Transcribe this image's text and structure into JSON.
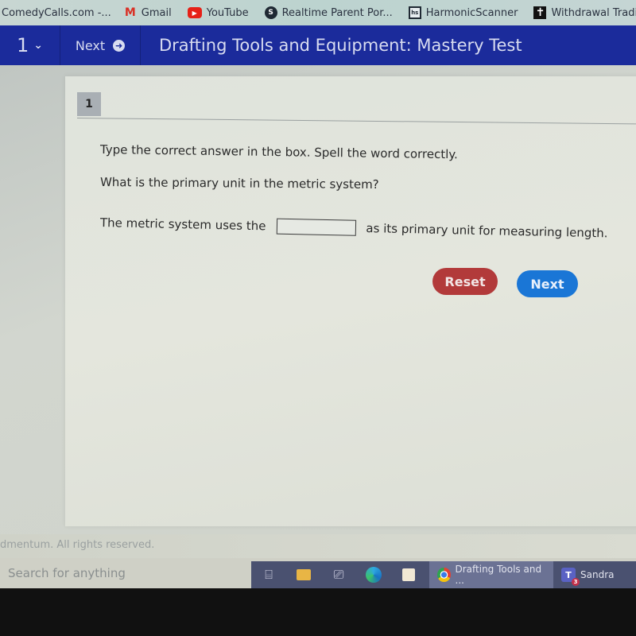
{
  "bookmarks": [
    {
      "label": "ComedyCalls.com -...",
      "icon": "none"
    },
    {
      "label": "Gmail",
      "icon": "gmail-icon"
    },
    {
      "label": "YouTube",
      "icon": "youtube-icon"
    },
    {
      "label": "Realtime Parent Por...",
      "icon": "realtime-parent-icon"
    },
    {
      "label": "HarmonicScanner",
      "icon": "harmonic-scanner-icon"
    },
    {
      "label": "Withdrawal Trading...",
      "icon": "withdrawal-trading-icon"
    }
  ],
  "header": {
    "question_selector": "1",
    "next_label": "Next",
    "title": "Drafting Tools and Equipment: Mastery Test"
  },
  "question": {
    "number": "1",
    "instruction": "Type the correct answer in the box. Spell the word correctly.",
    "prompt": "What is the primary unit in the metric system?",
    "sentence_before": "The metric system uses the",
    "answer_value": "",
    "sentence_after": "as its primary unit for measuring length.",
    "reset_label": "Reset",
    "next_label": "Next"
  },
  "footer": {
    "copyright": "dmentum. All rights reserved."
  },
  "taskbar": {
    "search_placeholder": "Search for anything",
    "active_window": "Drafting Tools and ...",
    "teams_label": "Sandra",
    "teams_badge": "3"
  },
  "colors": {
    "header_bg": "#1b2b9b",
    "reset_button": "#b23a3a",
    "next_button": "#1a76d6"
  }
}
